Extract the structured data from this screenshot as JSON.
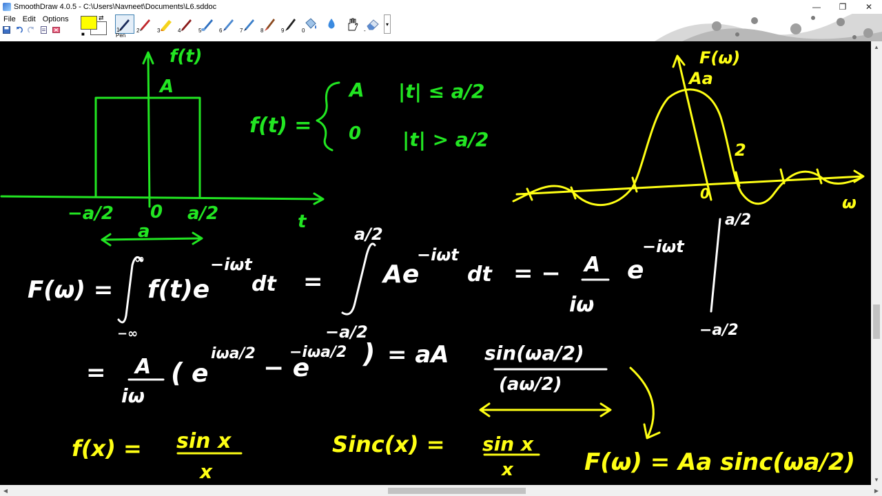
{
  "window": {
    "title": "SmoothDraw 4.0.5 - C:\\Users\\Navneet\\Documents\\L6.sddoc",
    "minimize": "—",
    "restore": "❐",
    "close": "✕"
  },
  "menu": {
    "items": [
      "File",
      "Edit",
      "Options"
    ]
  },
  "toolbar": {
    "tool_caption": "Pen",
    "tool_numbers": [
      "1",
      "2",
      "3",
      "4",
      "5",
      "6",
      "7",
      "8",
      "9",
      "0",
      "",
      "",
      "-"
    ],
    "colors": {
      "foreground": "#ffff00",
      "background": "#ffffff"
    }
  },
  "board": {
    "colors": {
      "green": "#22e622",
      "yellow": "#ffff14",
      "white": "#ffffff"
    },
    "green_notes": {
      "f_t_axis": "f(t)",
      "A_top": "A",
      "neg_a2": "−a/2",
      "zero": "0",
      "pos_a2": "a/2",
      "t_axis": "t",
      "a_width": "a",
      "piece_lhs": "f(t) =",
      "piece_A": "A",
      "piece_cond1": "|t| ≤ a/2",
      "piece_0": "0",
      "piece_cond2": "|t| > a/2"
    },
    "yellow_graph": {
      "F_w_axis": "F(ω)",
      "Aa": "Aa",
      "two": "2",
      "zero": "0",
      "w_axis": "ω"
    },
    "white_eq": {
      "F_w": "F(ω) =",
      "int_upper": "∞",
      "int_lower": "−∞",
      "integrand": "f(t)e",
      "exp1": "−iωt",
      "dt1": "dt",
      "eq2": "=",
      "upper2": "a/2",
      "lower2": "−a/2",
      "Ae": "Ae",
      "exp2": "−iωt",
      "dt2": "dt",
      "eq3": "= −",
      "frac_num_A": "A",
      "frac_den_iw": "iω",
      "e3": "e",
      "exp3": "−iωt",
      "eval_upper": "a/2",
      "eval_lower": "−a/2",
      "line2_eq": "=",
      "line2_num_A": "A",
      "line2_den_iw": "iω",
      "paren_open": "(",
      "e4": "e",
      "exp4": "iωa/2",
      "minus_e": "− e",
      "exp5": "−iωa/2",
      "paren_close": ")",
      "line2_eq2": "= aA",
      "sin_num": "sin(ωa/2)",
      "sin_den": "(aω/2)"
    },
    "yellow_eq": {
      "fx_lhs": "f(x) =",
      "fx_num": "sin x",
      "fx_den": "x",
      "sinc_lhs": "Sinc(x) =",
      "sinc_num": "sin x",
      "sinc_den": "x",
      "Fw_result": "F(ω) = Aa sinc(ωa/2)"
    }
  }
}
